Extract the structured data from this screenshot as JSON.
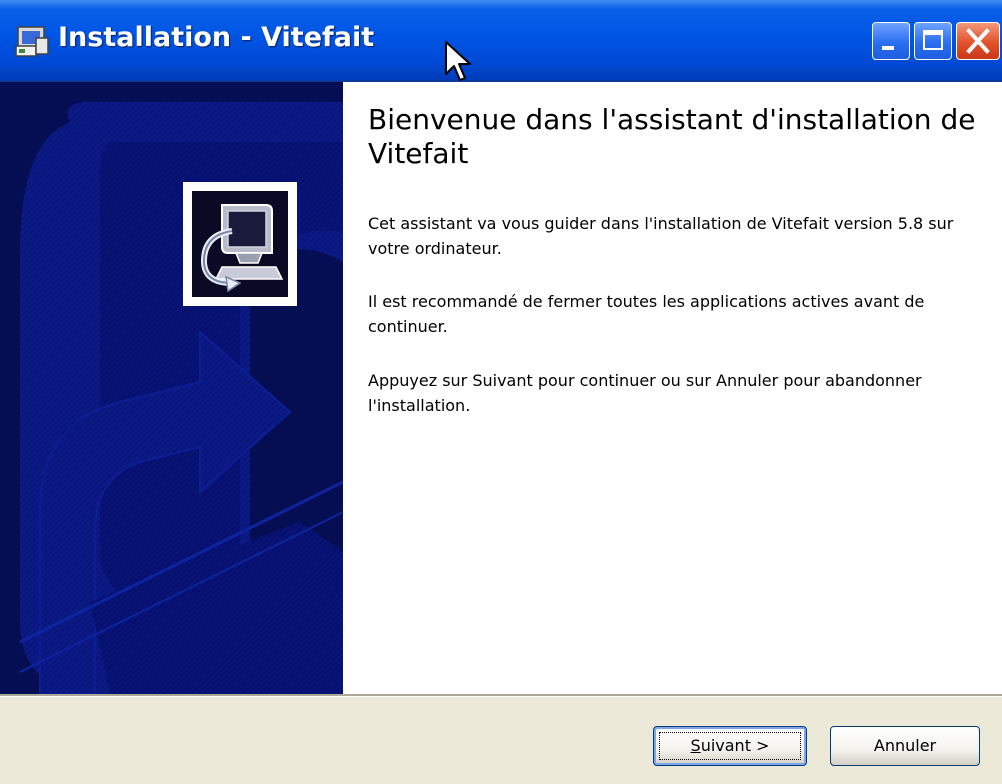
{
  "window": {
    "title": "Installation - Vitefait"
  },
  "main": {
    "heading": "Bienvenue dans l'assistant d'installation de Vitefait",
    "paragraphs": [
      "Cet assistant va vous guider dans l'installation de Vitefait version 5.8 sur votre ordinateur.",
      "Il est recommandé de fermer toutes les applications actives avant de continuer.",
      "Appuyez sur Suivant pour continuer ou sur Annuler pour abandonner l'installation."
    ]
  },
  "buttons": {
    "next_accel": "S",
    "next_rest": "uivant >",
    "cancel": "Annuler"
  },
  "icons": {
    "title_icon": "installer-icon",
    "logo": "computer-install-icon",
    "minimize": "minimize-icon",
    "maximize": "maximize-icon",
    "close": "close-icon"
  },
  "colors": {
    "title_bar": "#0055e5",
    "banner": "#06105a",
    "face": "#ece9d8"
  }
}
